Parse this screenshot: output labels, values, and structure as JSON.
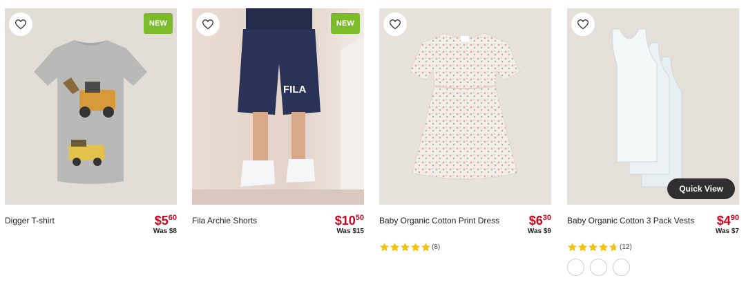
{
  "products": [
    {
      "name": "Digger T-shirt",
      "price_dollars": "$5",
      "price_cents": "60",
      "was": "Was $8",
      "badge": "NEW",
      "wishlist_icon": "heart-outline-icon"
    },
    {
      "name": "Fila Archie Shorts",
      "price_dollars": "$10",
      "price_cents": "50",
      "was": "Was $15",
      "badge": "NEW",
      "wishlist_icon": "heart-outline-icon"
    },
    {
      "name": "Baby Organic Cotton Print Dress",
      "price_dollars": "$6",
      "price_cents": "30",
      "was": "Was $9",
      "rating": 5,
      "review_count": "(8)",
      "wishlist_icon": "heart-outline-icon"
    },
    {
      "name": "Baby Organic Cotton 3 Pack Vests",
      "price_dollars": "$4",
      "price_cents": "90",
      "was": "Was $7",
      "rating": 4.5,
      "review_count": "(12)",
      "quick_view": "Quick View",
      "swatch_count": 3,
      "wishlist_icon": "heart-outline-icon"
    }
  ],
  "colors": {
    "price": "#d0021b",
    "badge": "#7cbc2a",
    "star": "#f4c20d",
    "quick_view_bg": "#2f2f2f"
  }
}
